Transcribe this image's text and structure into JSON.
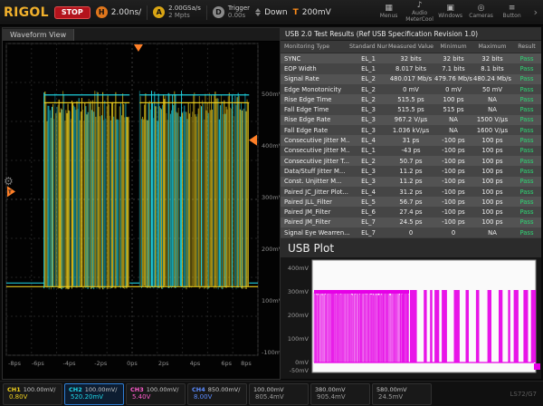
{
  "topbar": {
    "logo": "RIGOL",
    "stop_label": "STOP",
    "h_label": "H",
    "h_scale": "2.00ns/",
    "a_label": "A",
    "sample_rate": "2.00GSa/s",
    "mem_depth": "2 Mpts",
    "d_label": "D",
    "trigger_label": "Trigger",
    "trigger_pos": "0.00s",
    "slope_label": "Down",
    "t_label": "T",
    "trigger_level": "200mV",
    "buttons": [
      {
        "icon": "▦",
        "label": "Menus"
      },
      {
        "icon": "♪",
        "label": "Audio MeterCool"
      },
      {
        "icon": "▣",
        "label": "Windows"
      },
      {
        "icon": "◎",
        "label": "Cameras"
      },
      {
        "icon": "≡",
        "label": "Button"
      }
    ],
    "chevron": "›"
  },
  "waveform_view": {
    "title": "Waveform View",
    "voltage_labels": [
      "500mV",
      "400mV",
      "300mV",
      "200mV",
      "100mV",
      "-100mV"
    ],
    "time_labels": [
      "-8ps",
      "-6ps",
      "-4ps",
      "-2ps",
      "0ps",
      "2ps",
      "4ps",
      "6ps",
      "8ps"
    ],
    "channels": [
      {
        "name": "CH1",
        "color": "#f2d21f"
      },
      {
        "name": "CH2",
        "color": "#1fd8e8"
      }
    ],
    "bursts": [
      {
        "x0": 0.15,
        "x1": 0.49
      },
      {
        "x0": 0.53,
        "x1": 0.965
      }
    ]
  },
  "usb_table": {
    "title": "USB 2.0 Test Results (Ref USB Specification Revision 1.0)",
    "columns": [
      "Monitoring Type",
      "Standard Number",
      "Measured Value",
      "Minimum",
      "Maximum",
      "Result"
    ],
    "rows": [
      [
        "SYNC",
        "EL_1",
        "32 bits",
        "32 bits",
        "32 bits",
        "Pass"
      ],
      [
        "EOP Width",
        "EL_1",
        "8.017 bits",
        "7.1 bits",
        "8.1 bits",
        "Pass"
      ],
      [
        "Signal Rate",
        "EL_2",
        "480.017 Mb/s",
        "479.76 Mb/s",
        "480.24 Mb/s",
        "Pass"
      ],
      [
        "Edge Monotonicity",
        "EL_2",
        "0 mV",
        "0 mV",
        "50 mV",
        "Pass"
      ],
      [
        "Rise Edge Time",
        "EL_2",
        "515.5 ps",
        "100 ps",
        "NA",
        "Pass"
      ],
      [
        "Fall Edge Time",
        "EL_3",
        "515.5 ps",
        "515 ps",
        "NA",
        "Pass"
      ],
      [
        "Rise Edge Rate",
        "EL_3",
        "967.2 V/μs",
        "NA",
        "1500 V/μs",
        "Pass"
      ],
      [
        "Fall Edge Rate",
        "EL_3",
        "1.036 kV/μs",
        "NA",
        "1600 V/μs",
        "Pass"
      ],
      [
        "Consecutive Jitter M...",
        "EL_4",
        "31 ps",
        "-100 ps",
        "100 ps",
        "Pass"
      ],
      [
        "Consecutive Jitter M...",
        "EL_1",
        "-43 ps",
        "-100 ps",
        "100 ps",
        "Pass"
      ],
      [
        "Consecutive Jitter T...",
        "EL_2",
        "50.7 ps",
        "-100 ps",
        "100 ps",
        "Pass"
      ],
      [
        "Data/Stuff Jitter M...",
        "EL_3",
        "11.2 ps",
        "-100 ps",
        "100 ps",
        "Pass"
      ],
      [
        "Const. Unjitter M...",
        "EL_3",
        "11.2 ps",
        "-100 ps",
        "100 ps",
        "Pass"
      ],
      [
        "Paired JC_Jitter Plot...",
        "EL_4",
        "31.2 ps",
        "-100 ps",
        "100 ps",
        "Pass"
      ],
      [
        "Paired JLL_Filter",
        "EL_5",
        "56.7 ps",
        "-100 ps",
        "100 ps",
        "Pass"
      ],
      [
        "Paired JM_Filter",
        "EL_6",
        "27.4 ps",
        "-100 ps",
        "100 ps",
        "Pass"
      ],
      [
        "Paired JM_Filter",
        "EL_7",
        "24.5 ps",
        "-100 ps",
        "100 ps",
        "Pass"
      ],
      [
        "Signal Eye Wearren...",
        "EL_7",
        "0",
        "0",
        "NA",
        "Pass"
      ]
    ]
  },
  "usb_plot": {
    "title": "USB Plot",
    "y_labels": [
      "400mV",
      "300mV",
      "200mV",
      "100mV",
      "0mV",
      "-50mV"
    ],
    "color": "#e600e6"
  },
  "bottom_bar": {
    "channels": [
      {
        "tab": "CH1",
        "scale": "100.00mV/",
        "offset": "0.80V",
        "color": "#f2d21f",
        "selected": false
      },
      {
        "tab": "CH2",
        "scale": "100.00mV/",
        "offset": "520.20mV",
        "color": "#1fd8e8",
        "selected": true
      },
      {
        "tab": "CH3",
        "scale": "100.00mV/",
        "offset": "5.40V",
        "color": "#ff5ccd",
        "selected": false
      },
      {
        "tab": "CH4",
        "scale": "850.00mV/",
        "offset": "8.00V",
        "color": "#5c8cff",
        "selected": false
      },
      {
        "tab": "",
        "scale": "100.00mV",
        "offset": "805.4mV",
        "color": "#9a9a9a",
        "selected": false
      },
      {
        "tab": "",
        "scale": "380.00mV",
        "offset": "905.4mV",
        "color": "#9a9a9a",
        "selected": false
      },
      {
        "tab": "",
        "scale": "580.00mV",
        "offset": "24.5mV",
        "color": "#9a9a9a",
        "selected": false
      }
    ],
    "corner_text": "LS72/G7"
  }
}
